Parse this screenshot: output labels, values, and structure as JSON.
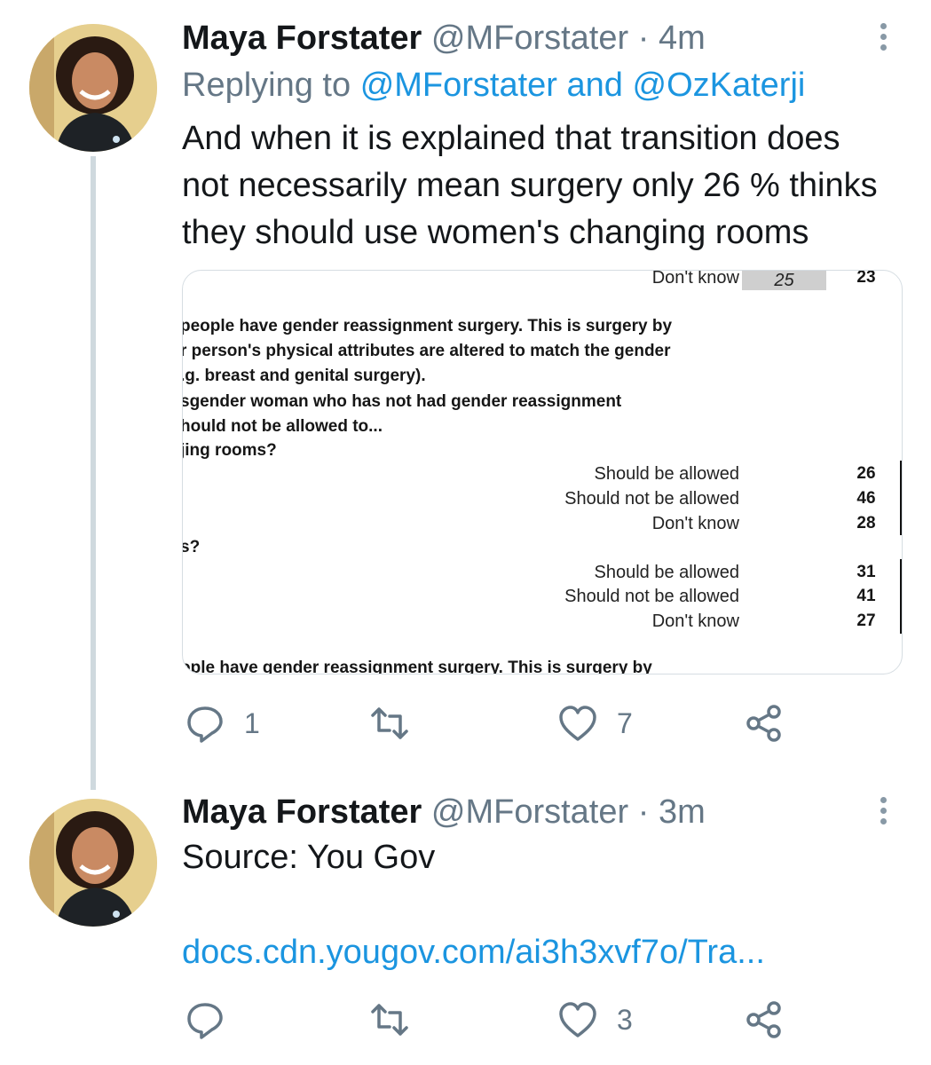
{
  "tweets": [
    {
      "name": "Maya Forstater",
      "handle": "@MForstater",
      "dot": "·",
      "time": "4m",
      "replying_prefix": "Replying to",
      "replying_to_1": "@MForstater",
      "replying_and": "and",
      "replying_to_2": "@OzKaterji",
      "text_lines": [
        "And when it is explained that transition does",
        "not necessarily mean surgery only 26 % thinks",
        "they should use women's changing rooms"
      ],
      "media": {
        "top_label": "Don't know",
        "top_shaded_value": "25",
        "top_value": "23",
        "question_lines": [
          "people have gender reassignment surgery. This is surgery by",
          "r person's physical attributes are altered to match the gender",
          ".g. breast and genital surgery).",
          "sgender woman who has not had gender reassignment",
          "hould not be allowed to...",
          "jing rooms?"
        ],
        "group1": [
          {
            "label": "Should be allowed",
            "value": "26"
          },
          {
            "label": "Should not be allowed",
            "value": "46"
          },
          {
            "label": "Don't know",
            "value": "28"
          }
        ],
        "question2": "s?",
        "group2": [
          {
            "label": "Should be allowed",
            "value": "31"
          },
          {
            "label": "Should not be allowed",
            "value": "41"
          },
          {
            "label": "Don't know",
            "value": "27"
          }
        ],
        "cut_line": "ople have gender reassignment surgery. This is surgery by"
      },
      "actions": {
        "replies": "1",
        "retweets": "",
        "likes": "7"
      }
    },
    {
      "name": "Maya Forstater",
      "handle": "@MForstater",
      "dot": "·",
      "time": "3m",
      "text": "Source: You Gov",
      "link": "docs.cdn.yougov.com/ai3h3xvf7o/Tra...",
      "actions": {
        "replies": "",
        "retweets": "",
        "likes": "3"
      }
    }
  ],
  "icons": [
    "reply-icon",
    "retweet-icon",
    "like-icon",
    "share-icon",
    "more-icon"
  ],
  "colors": {
    "link": "#1b95e0",
    "muted": "#657786",
    "text": "#14171a",
    "thread_line": "#cfd9de"
  }
}
